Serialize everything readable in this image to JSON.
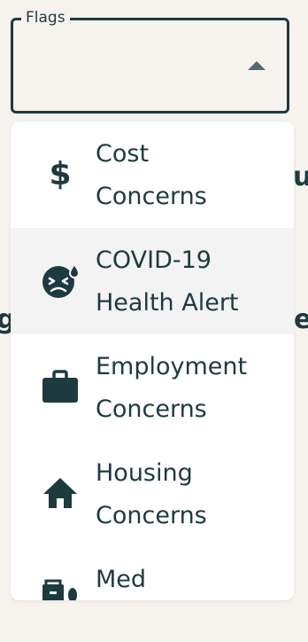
{
  "field": {
    "legend": "Flags"
  },
  "background": {
    "fragment_top": "u",
    "fragment_left": "g",
    "fragment_right": "e"
  },
  "menu": {
    "items": [
      {
        "line1": "Cost",
        "line2": "Concerns",
        "icon": "dollar-icon"
      },
      {
        "line1": "COVID-19",
        "line2": "Health Alert",
        "icon": "sick-face-icon"
      },
      {
        "line1": "Employment",
        "line2": "Concerns",
        "icon": "briefcase-icon"
      },
      {
        "line1": "Housing",
        "line2": "Concerns",
        "icon": "house-icon"
      },
      {
        "line1": "Med",
        "line2": "",
        "icon": "medical-icon"
      }
    ]
  },
  "colors": {
    "primary": "#1d3a3f",
    "background": "#f6f3ef",
    "highlight": "#f3f3f3"
  }
}
